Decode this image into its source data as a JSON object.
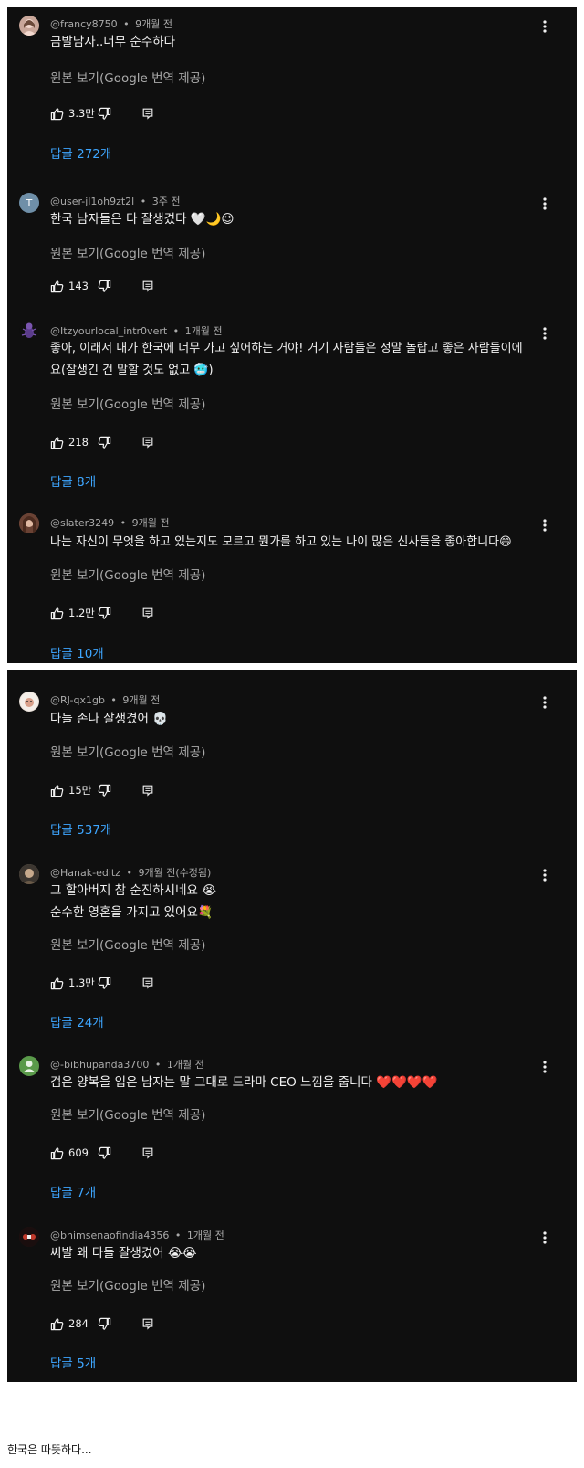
{
  "common": {
    "translate_label": "원본 보기(Google 번역 제공)",
    "separator": "•"
  },
  "panels": [
    {
      "comments": [
        {
          "handle": "@francy8750",
          "time": "9개월 전",
          "lines": [
            "금발남자..너무 순수하다"
          ],
          "likes": "3.3만",
          "replies": "답글 272개",
          "avatar_color": "#c9a79a",
          "avatar_letter": ""
        },
        {
          "handle": "@user-jl1oh9zt2l",
          "time": "3주 전",
          "lines": [
            "한국 남자들은 다 잘생겼다 🤍🌙😉"
          ],
          "likes": "143",
          "replies": "",
          "avatar_color": "#6f8fa8",
          "avatar_letter": "T"
        },
        {
          "handle": "@Itzyourlocal_intr0vert",
          "time": "1개월 전",
          "lines": [
            "좋아, 이래서 내가 한국에 너무 가고 싶어하는 거야! 거기 사람들은 정말 놀랍고 좋은 사람들이에",
            "요(잘생긴 건 말할 것도 없고 🥶)"
          ],
          "likes": "218",
          "replies": "답글 8개",
          "avatar_color": "#3a2a5a",
          "avatar_letter": ""
        },
        {
          "handle": "@slater3249",
          "time": "9개월 전",
          "lines": [
            "나는 자신이 무엇을 하고 있는지도 모르고 뭔가를 하고 있는 나이 많은 신사들을 좋아합니다😄"
          ],
          "likes": "1.2만",
          "replies": "답글 10개",
          "avatar_color": "#8a5a4a",
          "avatar_letter": ""
        }
      ]
    },
    {
      "comments": [
        {
          "handle": "@RJ-qx1gb",
          "time": "9개월 전",
          "lines": [
            "다들 존나 잘생겼어 💀"
          ],
          "likes": "15만",
          "replies": "답글 537개",
          "avatar_color": "#e8e0d8",
          "avatar_letter": ""
        },
        {
          "handle": "@Hanak-editz",
          "time": "9개월 전(수정됨)",
          "lines": [
            "그 할아버지 참 순진하시네요 😭",
            "순수한 영혼을 가지고 있어요💐"
          ],
          "likes": "1.3만",
          "replies": "답글 24개",
          "avatar_color": "#8a8070",
          "avatar_letter": ""
        },
        {
          "handle": "@-bibhupanda3700",
          "time": "1개월 전",
          "lines": [
            "검은 양복을 입은 남자는 말 그대로 드라마 CEO 느낌을 줍니다 ❤️❤️❤️❤️"
          ],
          "likes": "609",
          "replies": "답글 7개",
          "avatar_color": "#5a9a4a",
          "avatar_letter": ""
        },
        {
          "handle": "@bhimsenaofindia4356",
          "time": "1개월 전",
          "lines": [
            "씨발 왜 다들 잘생겼어 😭😭"
          ],
          "likes": "284",
          "replies": "답글 5개",
          "avatar_color": "#2a1a1a",
          "avatar_letter": ""
        }
      ]
    }
  ],
  "footer_text": "한국은 따뜻하다..."
}
